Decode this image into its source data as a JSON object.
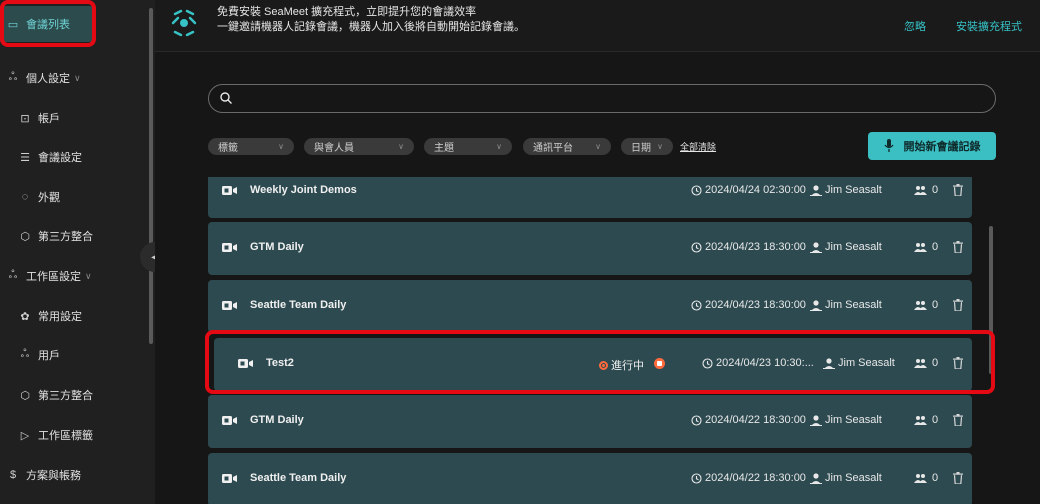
{
  "sidebar": {
    "items": [
      {
        "label": "會議列表",
        "icon": "calendar-icon"
      },
      {
        "label": "個人設定",
        "icon": "person-group-icon"
      },
      {
        "label": "帳戶",
        "icon": "account-icon"
      },
      {
        "label": "會議設定",
        "icon": "sliders-icon"
      },
      {
        "label": "外觀",
        "icon": "palette-icon"
      },
      {
        "label": "第三方整合",
        "icon": "integration-icon"
      },
      {
        "label": "工作區設定",
        "icon": "workspace-icon"
      },
      {
        "label": "常用設定",
        "icon": "gear-icon"
      },
      {
        "label": "用戶",
        "icon": "users-icon"
      },
      {
        "label": "第三方整合",
        "icon": "integration-icon"
      },
      {
        "label": "工作區標籤",
        "icon": "tag-icon"
      },
      {
        "label": "方案與帳務",
        "icon": "dollar-icon"
      }
    ]
  },
  "banner": {
    "line1": "免費安裝 SeaMeet 擴充程式，立即提升您的會議效率",
    "line2": "一鍵邀請機器人記錄會議，機器人加入後將自動開始記錄會議。",
    "ignore": "忽略",
    "install": "安裝擴充程式"
  },
  "search": {
    "placeholder": "",
    "value": ""
  },
  "filters": {
    "tags": "標籤",
    "participants": "與會人員",
    "topic": "主題",
    "platform": "通訊平台",
    "date": "日期",
    "clear_all": "全部清除"
  },
  "start_button": "開始新會議記錄",
  "meetings": [
    {
      "title": "Weekly Joint Demos",
      "status": "",
      "datetime": "2024/04/24 02:30:00",
      "owner": "Jim Seasalt",
      "participants": "0"
    },
    {
      "title": "GTM Daily",
      "status": "",
      "datetime": "2024/04/23 18:30:00",
      "owner": "Jim Seasalt",
      "participants": "0"
    },
    {
      "title": "Seattle Team Daily",
      "status": "",
      "datetime": "2024/04/23 18:30:00",
      "owner": "Jim Seasalt",
      "participants": "0"
    },
    {
      "title": "Test2",
      "status": "進行中",
      "datetime": "2024/04/23 10:30:...",
      "owner": "Jim Seasalt",
      "participants": "0"
    },
    {
      "title": "GTM Daily",
      "status": "",
      "datetime": "2024/04/22 18:30:00",
      "owner": "Jim Seasalt",
      "participants": "0"
    },
    {
      "title": "Seattle Team Daily",
      "status": "",
      "datetime": "2024/04/22 18:30:00",
      "owner": "Jim Seasalt",
      "participants": "0"
    }
  ],
  "colors": {
    "accent": "#3bbfc3",
    "row_bg": "#2d4a50",
    "highlight": "#e50914",
    "live": "#ff6a3d"
  }
}
